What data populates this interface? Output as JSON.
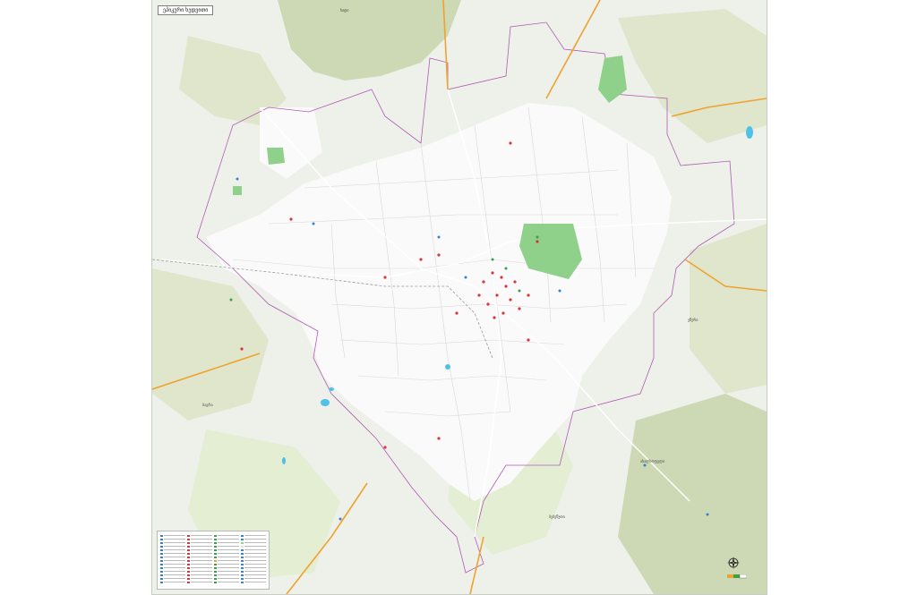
{
  "map": {
    "title": "ეპიკური ხედვითი",
    "colors": {
      "background": "#eef0ea",
      "forest": "#dfe6cc",
      "forest_dark": "#cdd8b4",
      "meadow": "#e3eed3",
      "urban": "#fafafa",
      "park": "#8fd08a",
      "water": "#4fc1e9",
      "road": "#ffffff",
      "highway": "#f0a22e",
      "boundary": "#b05bb5",
      "railway": "#9a9a9a",
      "poi_red": "#d9363e",
      "poi_blue": "#3a7fd0",
      "poi_green": "#3aa04a"
    },
    "places": [
      {
        "id": "place-north",
        "label": "ხიდი"
      },
      {
        "id": "place-east",
        "label": "ეწერი"
      },
      {
        "id": "place-west",
        "label": "ბაგრა"
      },
      {
        "id": "place-southeast",
        "label": "ახალსოფელი"
      },
      {
        "id": "place-south",
        "label": "ბებეწუთი"
      }
    ],
    "legend": {
      "columns": [
        {
          "symbols": [
            "#3a7fd0",
            "#3a7fd0",
            "#3a7fd0",
            "#3a7fd0",
            "#3a7fd0",
            "#3a7fd0",
            "#3a7fd0",
            "#3a7fd0",
            "#3a7fd0",
            "#3a7fd0",
            "#3a7fd0",
            "#3a7fd0",
            "#3a7fd0",
            "#3a7fd0"
          ]
        },
        {
          "symbols": [
            "#d9363e",
            "#d9363e",
            "#d9363e",
            "#d9363e",
            "#d9363e",
            "#d9363e",
            "#d9363e",
            "#d9363e",
            "#d9363e",
            "#d9363e",
            "#d9363e",
            "#d9363e",
            "#d9363e",
            "#d9363e"
          ]
        },
        {
          "symbols": [
            "#3aa04a",
            "#3aa04a",
            "#3aa04a",
            "#3aa04a",
            "#3aa04a",
            "#3aa04a",
            "#3aa04a",
            "#f0a22e",
            "#3aa04a",
            "#3aa04a",
            "#3aa04a",
            "#3aa04a",
            "#3aa04a",
            "#3aa04a"
          ]
        },
        {
          "symbols": [
            "#3a7fd0",
            "#3a7fd0",
            "#8fd08a",
            "#dfe6cc",
            "#3a7fd0",
            "#3a7fd0",
            "#3a7fd0",
            "#3a7fd0",
            "#3a7fd0",
            "#3a7fd0",
            "#3a7fd0",
            "#3a7fd0",
            "#3a7fd0",
            "#3a7fd0"
          ]
        }
      ]
    }
  }
}
